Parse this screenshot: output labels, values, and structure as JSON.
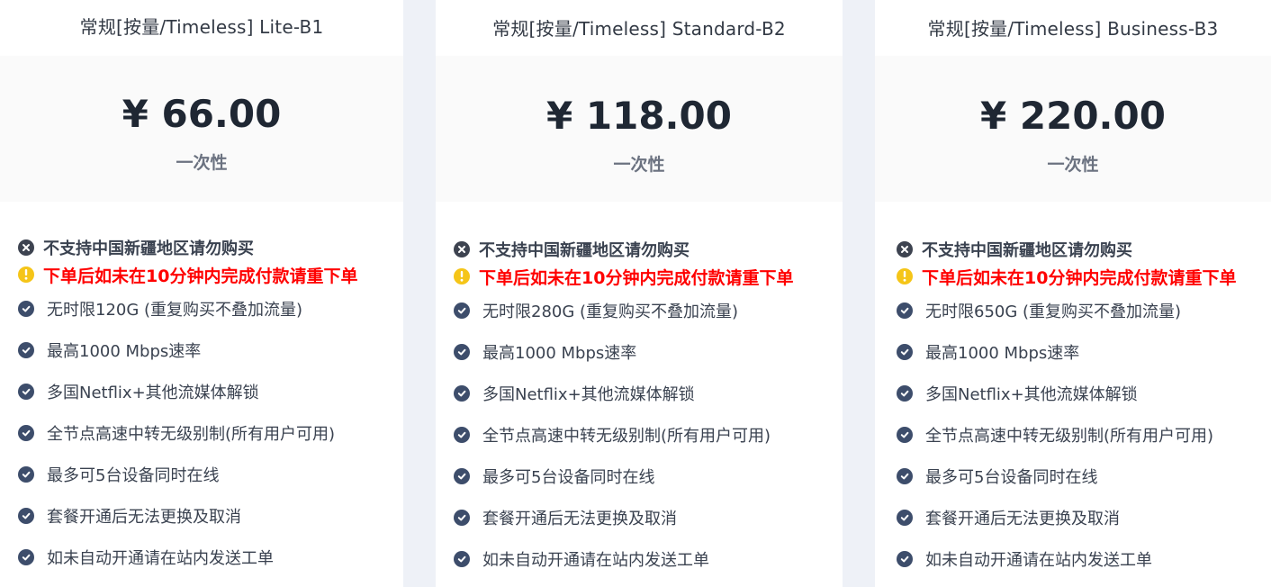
{
  "plans": [
    {
      "title": "常规[按量/Timeless] Lite-B1",
      "price": "¥ 66.00",
      "period": "一次性",
      "warning": "不支持中国新疆地区请勿购买",
      "alert": "下单后如未在10分钟内完成付款请重下单",
      "features": [
        "无时限120G (重复购买不叠加流量)",
        "最高1000 Mbps速率",
        "多国Netflix+其他流媒体解锁",
        "全节点高速中转无级别制(所有用户可用)",
        "最多可5台设备同时在线",
        "套餐开通后无法更换及取消",
        "如未自动开通请在站内发送工单"
      ]
    },
    {
      "title": "常规[按量/Timeless] Standard-B2",
      "price": "¥ 118.00",
      "period": "一次性",
      "warning": "不支持中国新疆地区请勿购买",
      "alert": "下单后如未在10分钟内完成付款请重下单",
      "features": [
        "无时限280G (重复购买不叠加流量)",
        "最高1000 Mbps速率",
        "多国Netflix+其他流媒体解锁",
        "全节点高速中转无级别制(所有用户可用)",
        "最多可5台设备同时在线",
        "套餐开通后无法更换及取消",
        "如未自动开通请在站内发送工单"
      ]
    },
    {
      "title": "常规[按量/Timeless] Business-B3",
      "price": "¥ 220.00",
      "period": "一次性",
      "warning": "不支持中国新疆地区请勿购买",
      "alert": "下单后如未在10分钟内完成付款请重下单",
      "features": [
        "无时限650G (重复购买不叠加流量)",
        "最高1000 Mbps速率",
        "多国Netflix+其他流媒体解锁",
        "全节点高速中转无级别制(所有用户可用)",
        "最多可5台设备同时在线",
        "套餐开通后无法更换及取消",
        "如未自动开通请在站内发送工单"
      ]
    }
  ],
  "icons": {
    "warning": "circle-x-icon",
    "alert": "exclamation-circle-icon",
    "feature": "check-circle-icon"
  },
  "colors": {
    "page_bg": "#eef1f7",
    "card_bg": "#ffffff",
    "price_bg": "#fafafa",
    "check": "#3d4d6b",
    "alert_icon": "#f5c518",
    "alert_text": "#ff0000"
  }
}
